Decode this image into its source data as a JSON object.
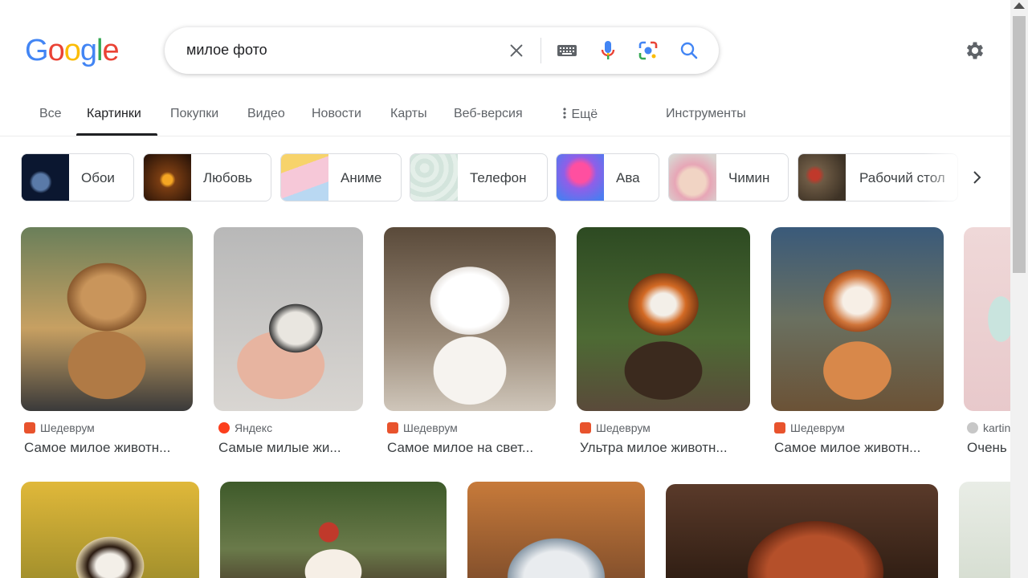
{
  "logo": {
    "letters": [
      "G",
      "o",
      "o",
      "g",
      "l",
      "e"
    ],
    "colors": [
      "#4285F4",
      "#EA4335",
      "#FBBC05",
      "#4285F4",
      "#34A853",
      "#EA4335"
    ]
  },
  "search": {
    "query": "милое фото"
  },
  "tabs": [
    {
      "label": "Все"
    },
    {
      "label": "Картинки"
    },
    {
      "label": "Покупки"
    },
    {
      "label": "Видео"
    },
    {
      "label": "Новости"
    },
    {
      "label": "Карты"
    },
    {
      "label": "Веб-версия"
    },
    {
      "label": "Ещё"
    },
    {
      "label": "Инструменты"
    }
  ],
  "chips": [
    {
      "label": "Обои"
    },
    {
      "label": "Любовь"
    },
    {
      "label": "Аниме"
    },
    {
      "label": "Телефон"
    },
    {
      "label": "Ава"
    },
    {
      "label": "Чимин"
    },
    {
      "label": "Рабочий стол"
    }
  ],
  "results": [
    {
      "source": "Шедеврум",
      "title": "Самое милое животн..."
    },
    {
      "source": "Яндекс",
      "title": "Самые милые жи..."
    },
    {
      "source": "Шедеврум",
      "title": "Самое милое на свет..."
    },
    {
      "source": "Шедеврум",
      "title": "Ультра милое животн..."
    },
    {
      "source": "Шедеврум",
      "title": "Самое милое животн..."
    },
    {
      "source": "kartin",
      "title": "Очень"
    }
  ],
  "icons": {
    "clear": "close-icon",
    "keyboard": "keyboard-icon",
    "voice": "microphone-icon",
    "lens": "camera-lens-icon",
    "search": "search-icon",
    "settings": "gear-icon",
    "more": "dots-vertical-icon",
    "next": "chevron-right-icon"
  }
}
